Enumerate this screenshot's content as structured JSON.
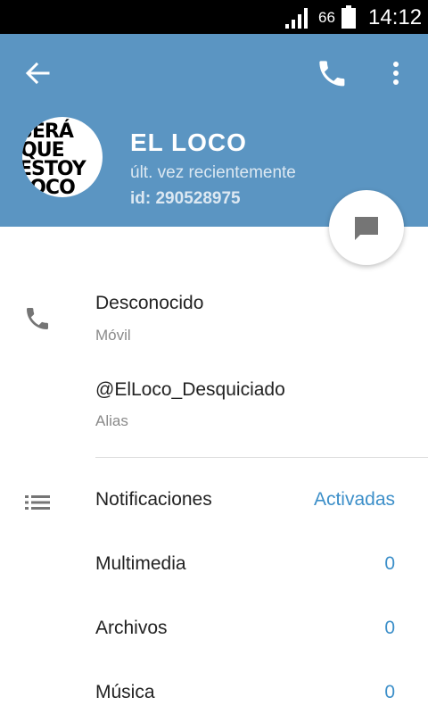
{
  "status_bar": {
    "battery_percent": "66",
    "time": "14:12"
  },
  "header": {
    "background_color": "#5b95c2",
    "name": "EL LOCO",
    "last_seen": "últ. vez recientemente",
    "user_id": "id: 290528975",
    "avatar_lines": [
      "SERÁ",
      "QUE",
      "ESTOY",
      "LOCO"
    ]
  },
  "contact": {
    "phone_value": "Desconocido",
    "phone_label": "Móvil",
    "alias_value": "@ElLoco_Desquiciado",
    "alias_label": "Alias"
  },
  "settings": {
    "notifications_label": "Notificaciones",
    "notifications_value": "Activadas",
    "media_label": "Multimedia",
    "media_value": "0",
    "files_label": "Archivos",
    "files_value": "0",
    "music_label": "Música",
    "music_value": "0"
  },
  "colors": {
    "accent": "#3c8fc9",
    "icon_gray": "#757575"
  }
}
